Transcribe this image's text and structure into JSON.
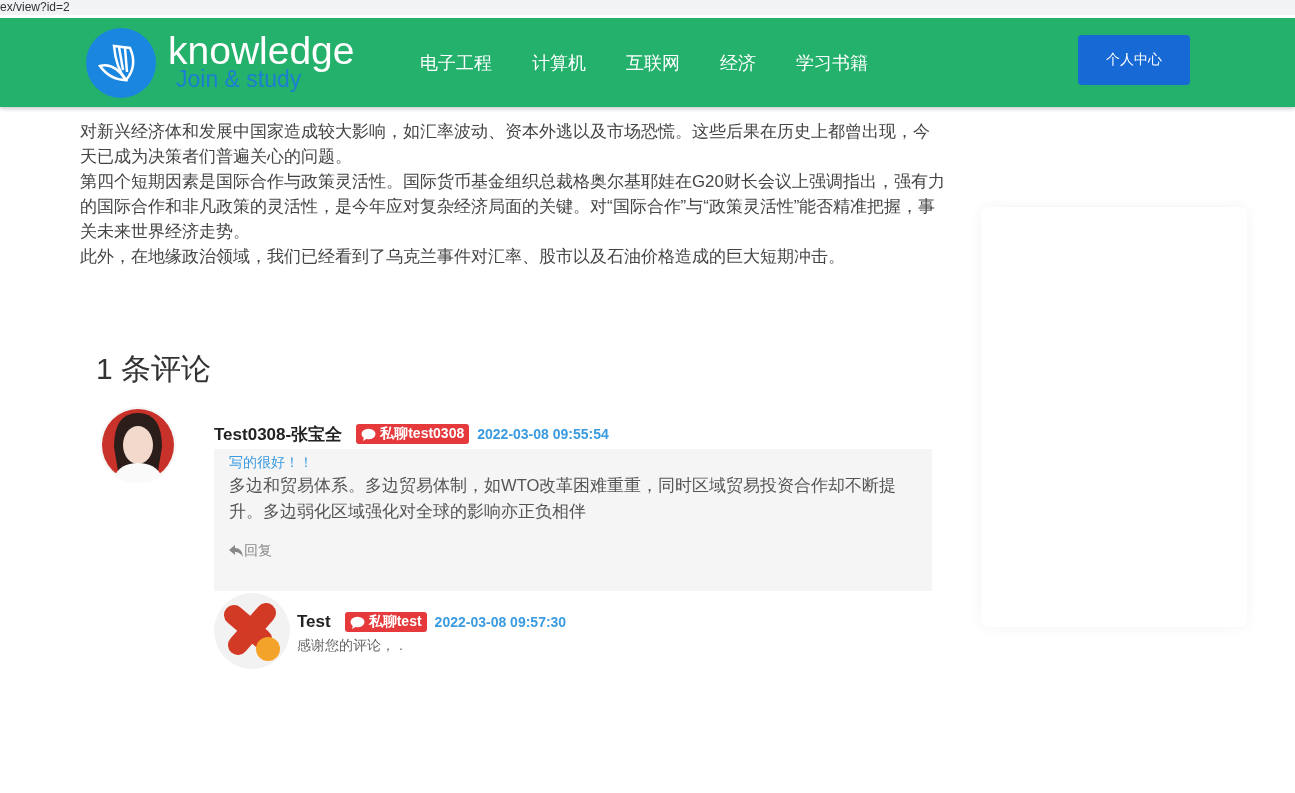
{
  "address": "ex/view?id=2",
  "header": {
    "logo": {
      "name": "knowledge",
      "slogan": "Join & study"
    },
    "nav": [
      "电子工程",
      "计算机",
      "互联网",
      "经济",
      "学习书籍"
    ],
    "user_button": "个人中心"
  },
  "article": {
    "paragraphs": [
      "对新兴经济体和发展中国家造成较大影响，如汇率波动、资本外逃以及市场恐慌。这些后果在历史上都曾出现，今天已成为决策者们普遍关心的问题。",
      "第四个短期因素是国际合作与政策灵活性。国际货币基金组织总裁格奥尔基耶娃在G20财长会议上强调指出，强有力的国际合作和非凡政策的灵活性，是今年应对复杂经济局面的关键。对“国际合作”与“政策灵活性”能否精准把握，事关未来世界经济走势。",
      "此外，在地缘政治领域，我们已经看到了乌克兰事件对汇率、股市以及石油价格造成的巨大短期冲击。"
    ]
  },
  "comments": {
    "title": "1 条评论",
    "items": [
      {
        "author": "Test0308-张宝全",
        "badge": "私聊test0308",
        "time": "2022-03-08 09:55:54",
        "quote": "写的很好！！",
        "text": "多边和贸易体系。多边贸易体制，如WTO改革困难重重，同时区域贸易投资合作却不断提升。多边弱化区域强化对全球的影响亦正负相伴",
        "reply_action": "回复",
        "replies": [
          {
            "author": "Test",
            "badge": "私聊test",
            "time": "2022-03-08 09:57:30",
            "text": "感谢您的评论， ."
          }
        ]
      }
    ]
  }
}
